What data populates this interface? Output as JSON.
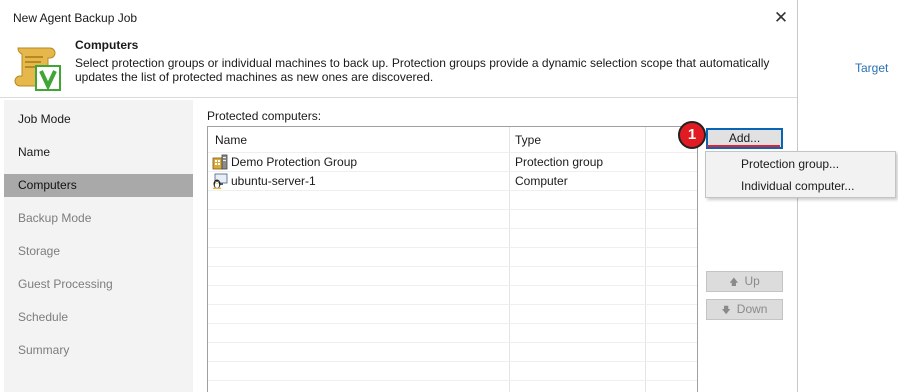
{
  "window": {
    "title": "New Agent Backup Job",
    "close_glyph": "✕"
  },
  "header": {
    "title": "Computers",
    "description": "Select protection groups or individual machines to back up. Protection groups provide a dynamic selection scope that automatically updates the list of protected machines as new ones are discovered.",
    "icon": "veeam-job-icon"
  },
  "nav": {
    "items": [
      {
        "label": "Job Mode",
        "state": "done"
      },
      {
        "label": "Name",
        "state": "done"
      },
      {
        "label": "Computers",
        "state": "active"
      },
      {
        "label": "Backup Mode",
        "state": "pending"
      },
      {
        "label": "Storage",
        "state": "pending"
      },
      {
        "label": "Guest Processing",
        "state": "pending"
      },
      {
        "label": "Schedule",
        "state": "pending"
      },
      {
        "label": "Summary",
        "state": "pending"
      }
    ]
  },
  "content": {
    "label": "Protected computers:",
    "columns": [
      "Name",
      "Type"
    ],
    "rows": [
      {
        "name": "Demo Protection Group",
        "type": "Protection group",
        "icon": "protection-group-icon"
      },
      {
        "name": "ubuntu-server-1",
        "type": "Computer",
        "icon": "linux-computer-icon"
      }
    ]
  },
  "buttons": {
    "add": "Add...",
    "up": "Up",
    "down": "Down",
    "up_arrow": "🡅",
    "down_arrow": "🡇"
  },
  "step_badge": "1",
  "add_menu": {
    "items": [
      "Protection group...",
      "Individual computer..."
    ]
  },
  "background": {
    "target_link": "Target"
  },
  "colors": {
    "accent": "#0a64b5",
    "badge": "#e11b22",
    "nav_active": "#a9a9a9",
    "link": "#2b6fb5"
  }
}
